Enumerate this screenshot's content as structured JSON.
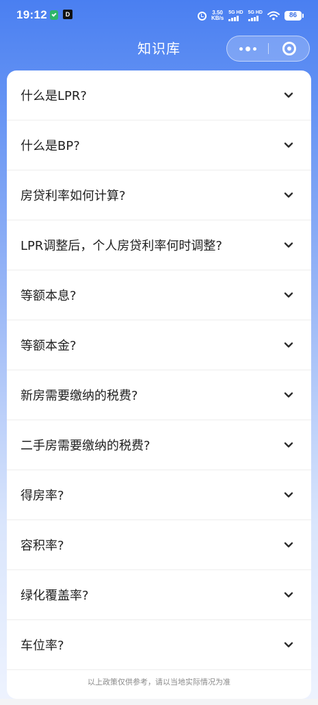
{
  "status_bar": {
    "time": "19:12",
    "app_icon_letter": "D",
    "net_speed_value": "3.50",
    "net_speed_unit": "KB/s",
    "signal1_label": "5G HD",
    "signal2_label": "5G HD",
    "battery": "86"
  },
  "header": {
    "title": "知识库"
  },
  "faq": {
    "items": [
      {
        "question": "什么是LPR?"
      },
      {
        "question": "什么是BP?"
      },
      {
        "question": "房贷利率如何计算?"
      },
      {
        "question": "LPR调整后，个人房贷利率何时调整?"
      },
      {
        "question": "等额本息?"
      },
      {
        "question": "等额本金?"
      },
      {
        "question": "新房需要缴纳的税费?"
      },
      {
        "question": "二手房需要缴纳的税费?"
      },
      {
        "question": "得房率?"
      },
      {
        "question": "容积率?"
      },
      {
        "question": "绿化覆盖率?"
      },
      {
        "question": "车位率?"
      }
    ]
  },
  "footer": {
    "disclaimer": "以上政策仅供参考，请以当地实际情况为准"
  },
  "colors": {
    "header_blue": "#4a7ff1",
    "text_dark": "#1f1f1f",
    "disclaimer_gray": "#8a8a8a"
  }
}
